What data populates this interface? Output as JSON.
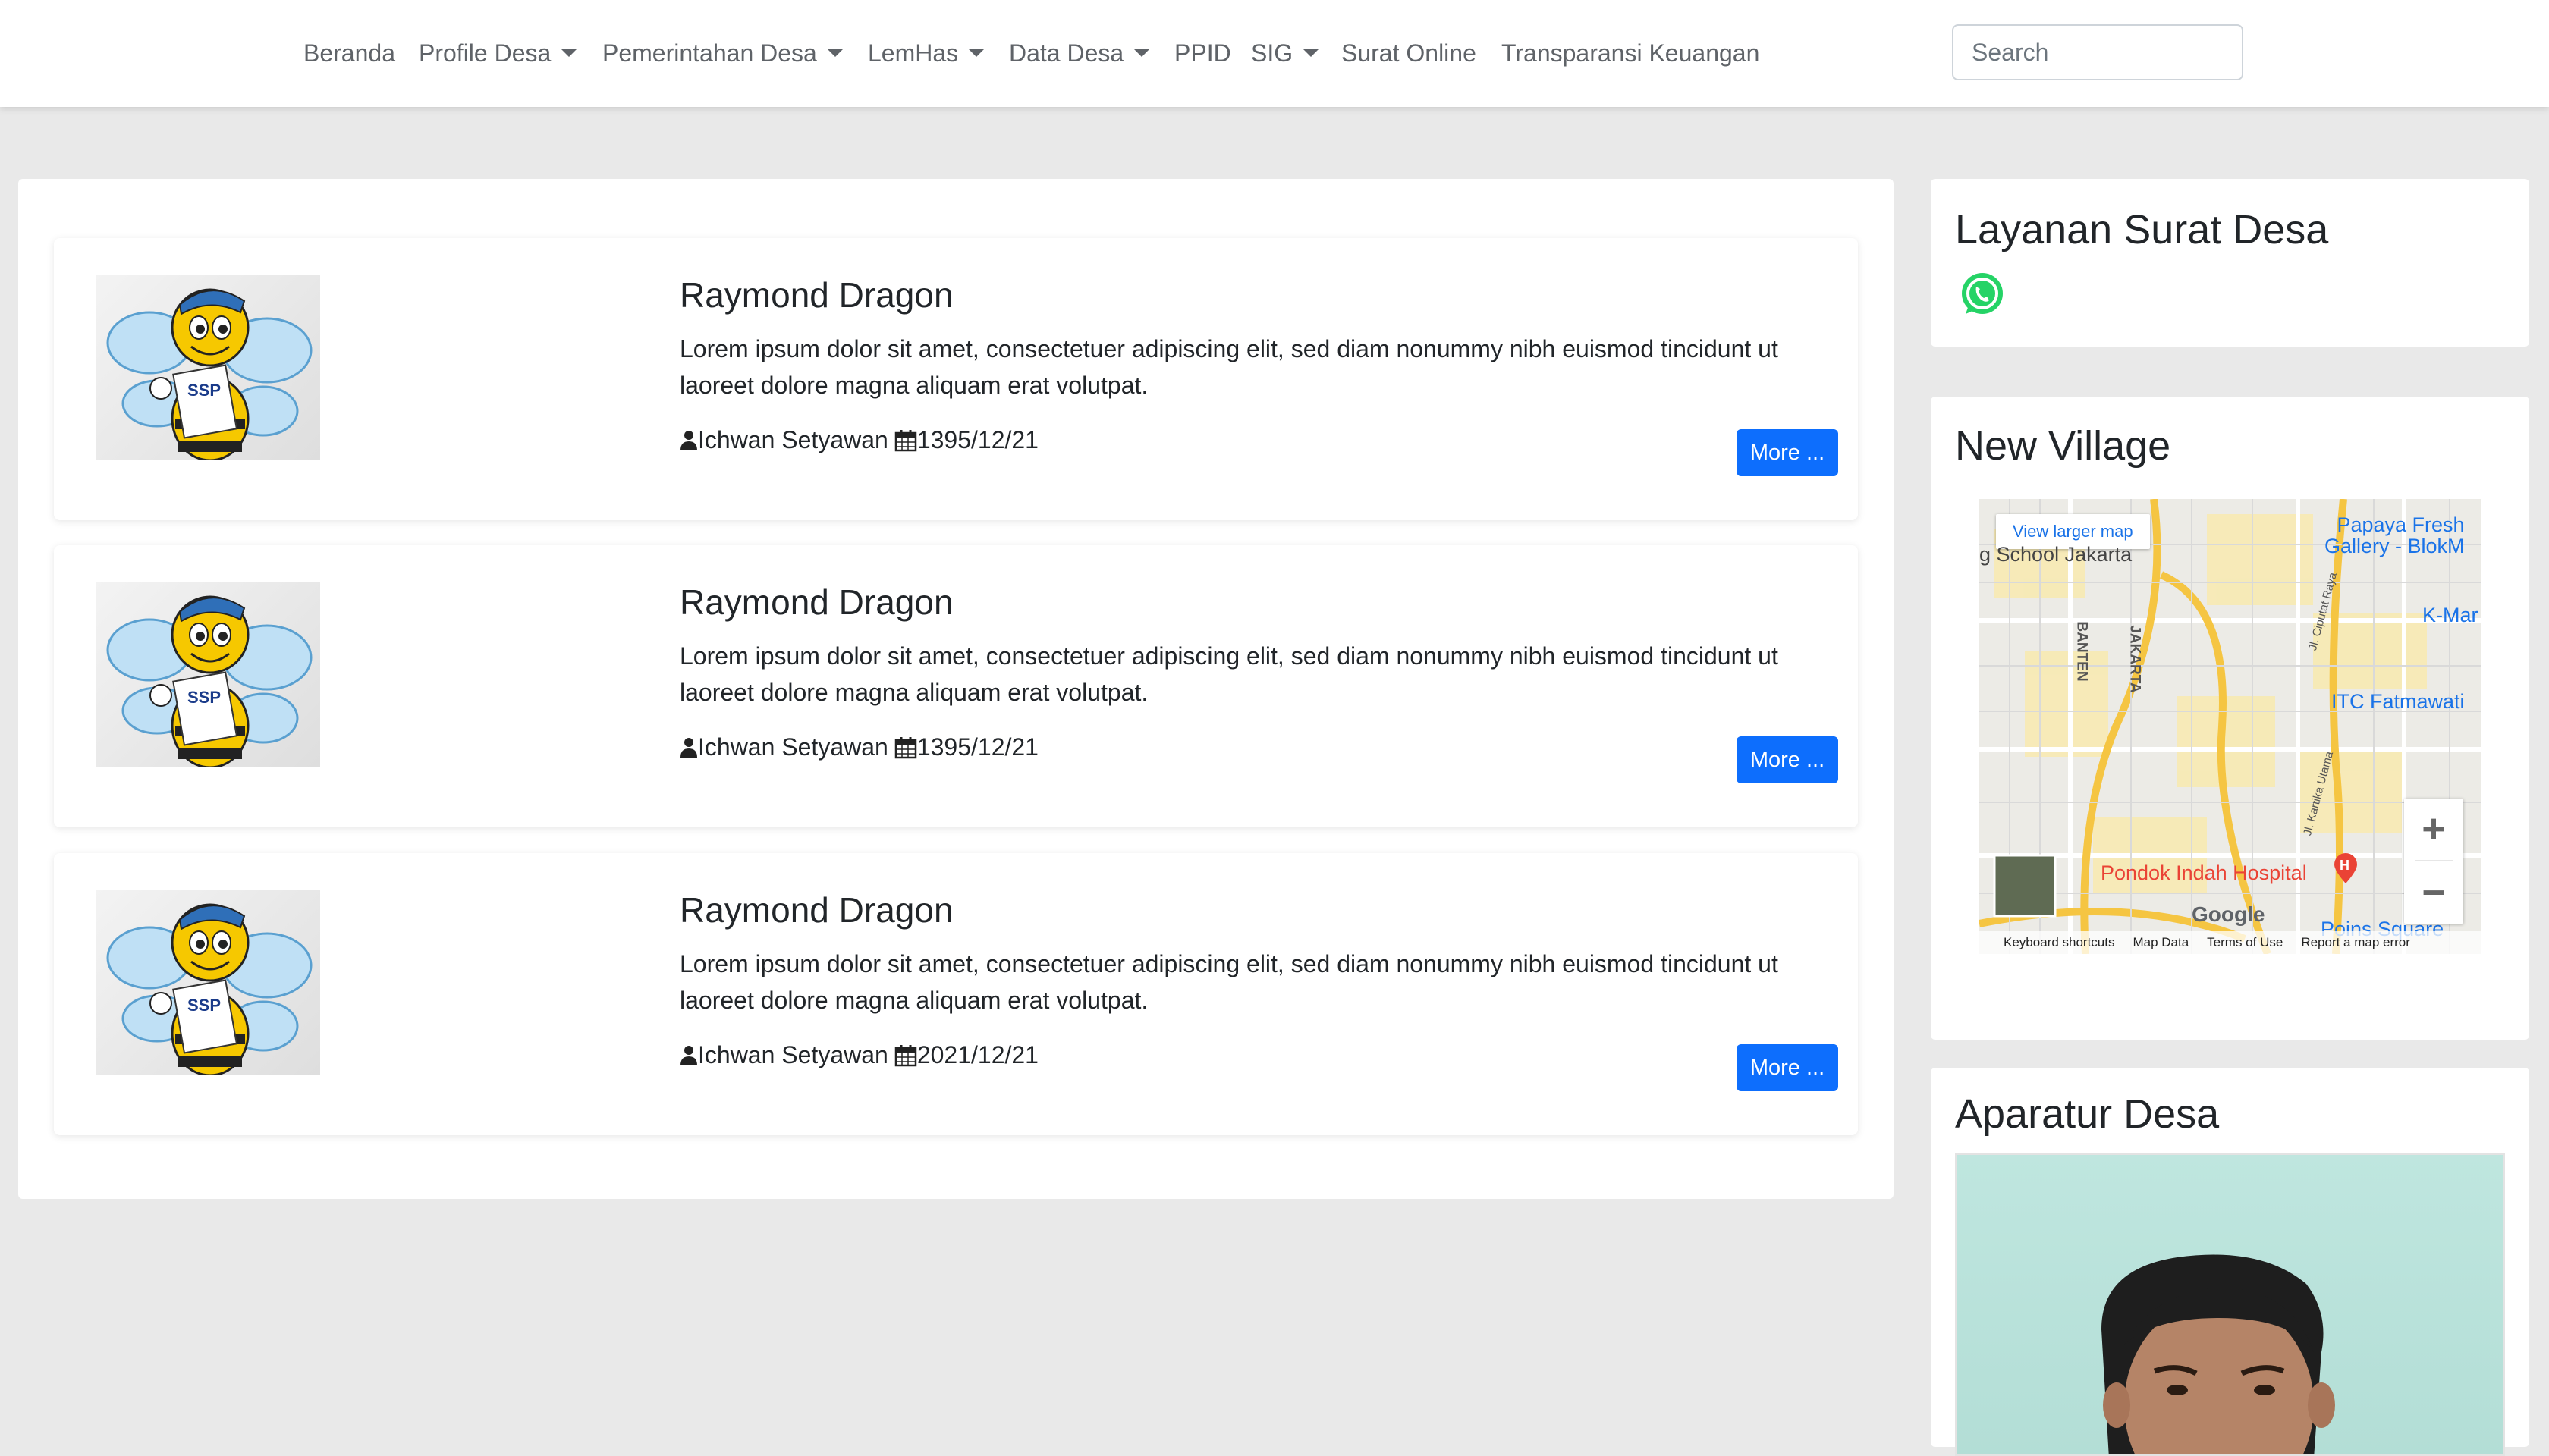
{
  "nav": {
    "items": [
      {
        "label": "Beranda",
        "dropdown": false
      },
      {
        "label": "Profile Desa",
        "dropdown": true
      },
      {
        "label": "Pemerintahan Desa",
        "dropdown": true
      },
      {
        "label": "LemHas",
        "dropdown": true
      },
      {
        "label": "Data Desa",
        "dropdown": true
      },
      {
        "label": "PPID",
        "dropdown": false
      },
      {
        "label": "SIG",
        "dropdown": true
      },
      {
        "label": "Surat Online",
        "dropdown": false
      },
      {
        "label": "Transparansi Keuangan",
        "dropdown": false
      }
    ],
    "search_placeholder": "Search"
  },
  "posts": [
    {
      "title": "Raymond Dragon",
      "body": "Lorem ipsum dolor sit amet, consectetuer adipiscing elit, sed diam nonummy nibh euismod tincidunt ut laoreet dolore magna aliquam erat volutpat.",
      "author": "Ichwan Setyawan",
      "date": "1395/12/21",
      "button": "More ...",
      "thumb_text": "SSP"
    },
    {
      "title": "Raymond Dragon",
      "body": "Lorem ipsum dolor sit amet, consectetuer adipiscing elit, sed diam nonummy nibh euismod tincidunt ut laoreet dolore magna aliquam erat volutpat.",
      "author": "Ichwan Setyawan",
      "date": "1395/12/21",
      "button": "More ...",
      "thumb_text": "SSP"
    },
    {
      "title": "Raymond Dragon",
      "body": "Lorem ipsum dolor sit amet, consectetuer adipiscing elit, sed diam nonummy nibh euismod tincidunt ut laoreet dolore magna aliquam erat volutpat.",
      "author": "Ichwan Setyawan",
      "date": "2021/12/21",
      "button": "More ...",
      "thumb_text": "SSP"
    }
  ],
  "sidebar": {
    "layanan": {
      "title": "Layanan Surat Desa",
      "icon": "whatsapp-icon",
      "icon_color": "#25d366"
    },
    "village": {
      "title": "New Village",
      "map": {
        "view_larger": "View larger map",
        "labels": {
          "school": "g School Jakarta",
          "papaya": "Papaya Fresh\nGallery - BlokM",
          "kmart": "K-Mar",
          "itc": "ITC Fatmawati",
          "hospital": "Pondok Indah Hospital",
          "poins": "Poins Square",
          "banten": "BANTEN",
          "jakarta": "JAKARTA",
          "ciputat": "Jl. Ciputat Raya",
          "kartika": "Jl. Kartika Utama"
        },
        "zoom_in": "+",
        "zoom_out": "−",
        "google": "Google",
        "footer": [
          "Keyboard shortcuts",
          "Map Data",
          "Terms of Use",
          "Report a map error"
        ]
      }
    },
    "aparatur": {
      "title": "Aparatur Desa"
    }
  },
  "colors": {
    "primary": "#0d6efd",
    "hospital": "#ea4335",
    "map_link": "#1a73e8"
  }
}
